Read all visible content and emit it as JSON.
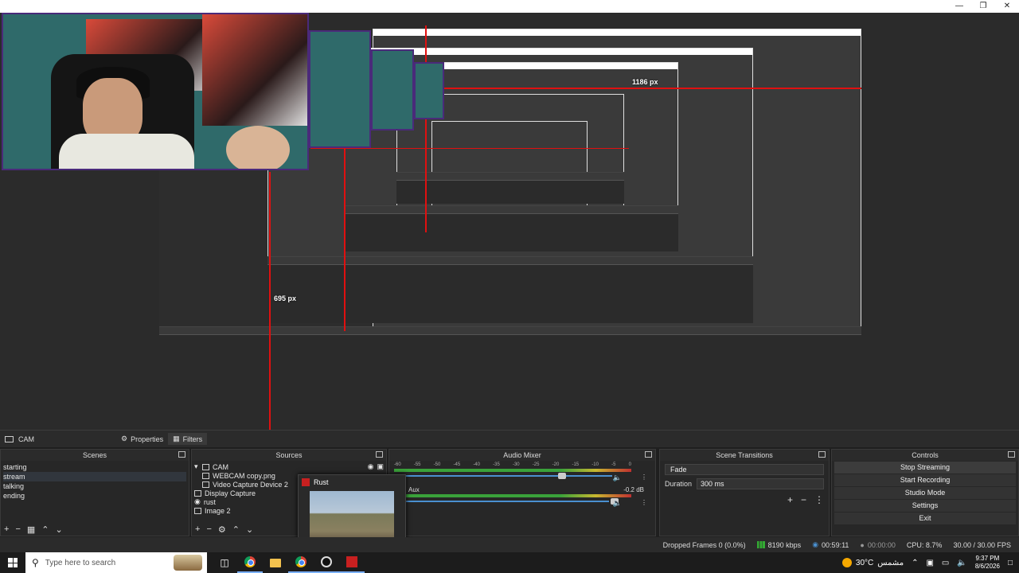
{
  "preview": {
    "measure_horizontal": "1186 px",
    "measure_vertical": "695 px"
  },
  "scenebar": {
    "scene_name": "CAM",
    "properties_label": "Properties",
    "filters_label": "Filters"
  },
  "scenes": {
    "title": "Scenes",
    "items": [
      "starting",
      "stream",
      "talking",
      "ending"
    ],
    "selected_index": 1
  },
  "sources": {
    "title": "Sources",
    "items": [
      {
        "label": "CAM",
        "icon": "folder-icon"
      },
      {
        "label": "WEBCAM copy.png",
        "icon": "image-icon"
      },
      {
        "label": "Video Capture Device 2",
        "icon": "camera-icon"
      },
      {
        "label": "Display Capture",
        "icon": "monitor-icon"
      },
      {
        "label": "rust",
        "icon": "eye-icon"
      },
      {
        "label": "Image 2",
        "icon": "image-icon"
      }
    ]
  },
  "audio_mixer": {
    "title": "Audio Mixer",
    "scale": [
      "-60",
      "-55",
      "-50",
      "-45",
      "-40",
      "-35",
      "-30",
      "-25",
      "-20",
      "-15",
      "-10",
      "-5",
      "0"
    ],
    "channels": [
      {
        "name": "",
        "db": ""
      },
      {
        "name": "Aux",
        "db": "-0.2 dB"
      }
    ]
  },
  "scene_transitions": {
    "title": "Scene Transitions",
    "transition": "Fade",
    "duration_label": "Duration",
    "duration_value": "300 ms"
  },
  "controls": {
    "title": "Controls",
    "buttons": [
      "Stop Streaming",
      "Start Recording",
      "Studio Mode",
      "Settings",
      "Exit"
    ]
  },
  "taskbar_popup": {
    "title": "Rust"
  },
  "status": {
    "dropped_frames": "Dropped Frames 0 (0.0%)",
    "bitrate": "8190 kbps",
    "stream_time": "00:59:11",
    "record_time": "00:00:00",
    "cpu": "CPU: 8.7%",
    "fps": "30.00 / 30.00 FPS"
  },
  "taskbar": {
    "search_placeholder": "Type here to search",
    "weather_temp": "30°C",
    "weather_desc": "مشمس",
    "time": "9:37 PM",
    "date": "8/6/2026"
  }
}
